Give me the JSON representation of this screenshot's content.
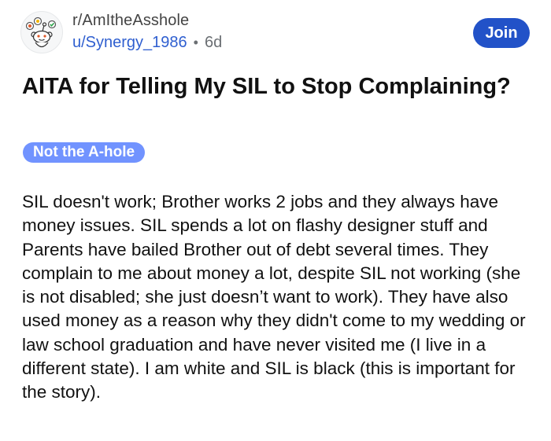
{
  "post": {
    "subreddit": "r/AmItheAsshole",
    "username": "u/Synergy_1986",
    "separator": "•",
    "age": "6d",
    "join_label": "Join",
    "title": "AITA for Telling My SIL to Stop Complaining?",
    "flair": "Not the A-hole",
    "body": "SIL doesn't work; Brother works 2 jobs and they always have money issues. SIL spends a lot on flashy designer stuff and Parents have bailed Brother out of debt several times. They complain to me about money a lot, despite SIL not working (she is not disabled; she just doesn’t want to work). They have also used money as a reason why they didn't come to my wedding or law school graduation and have never visited me (I live in a different state). I am white and SIL is black (this is important for the story)."
  },
  "icons": {
    "avatar": "snoo-avatar-icon"
  },
  "colors": {
    "join_button": "#2252c8",
    "flair_background": "#7193ff",
    "username": "#2f5fd0"
  }
}
